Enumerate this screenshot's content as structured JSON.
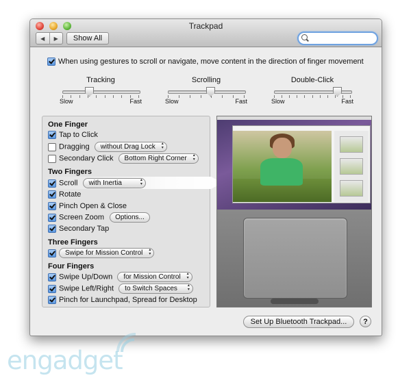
{
  "window": {
    "title": "Trackpad"
  },
  "toolbar": {
    "back_icon": "◀",
    "forward_icon": "▶",
    "show_all_label": "Show All",
    "search_value": ""
  },
  "gesture_pref": {
    "label": "When using gestures to scroll or navigate, move content in the direction of finger movement",
    "checked": true
  },
  "sliders": [
    {
      "label": "Tracking",
      "min_label": "Slow",
      "max_label": "Fast",
      "value": 0.35,
      "ticks": 10
    },
    {
      "label": "Scrolling",
      "min_label": "Slow",
      "max_label": "Fast",
      "value": 0.55,
      "ticks": 8
    },
    {
      "label": "Double-Click",
      "min_label": "Slow",
      "max_label": "Fast",
      "value": 0.82,
      "ticks": 11
    }
  ],
  "one_finger": {
    "heading": "One Finger",
    "tap_to_click": {
      "label": "Tap to Click",
      "checked": true
    },
    "dragging": {
      "label": "Dragging",
      "checked": false,
      "option": "without Drag Lock"
    },
    "secondary_click": {
      "label": "Secondary Click",
      "checked": false,
      "option": "Bottom Right Corner"
    }
  },
  "two_fingers": {
    "heading": "Two Fingers",
    "scroll": {
      "label": "Scroll",
      "checked": true,
      "option": "with Inertia"
    },
    "rotate": {
      "label": "Rotate",
      "checked": true
    },
    "pinch": {
      "label": "Pinch Open & Close",
      "checked": true
    },
    "screen_zoom": {
      "label": "Screen Zoom",
      "checked": true,
      "button": "Options..."
    },
    "secondary_tap": {
      "label": "Secondary Tap",
      "checked": true
    }
  },
  "three_fingers": {
    "heading": "Three Fingers",
    "swipe": {
      "checked": true,
      "option": "Swipe for Mission Control"
    }
  },
  "four_fingers": {
    "heading": "Four Fingers",
    "swipe_updown": {
      "label": "Swipe Up/Down",
      "checked": true,
      "option": "for Mission Control"
    },
    "swipe_leftright": {
      "label": "Swipe Left/Right",
      "checked": true,
      "option": "to Switch Spaces"
    },
    "pinch_launchpad": {
      "label": "Pinch for Launchpad, Spread for Desktop",
      "checked": true
    }
  },
  "footer": {
    "bluetooth_button": "Set Up Bluetooth Trackpad...",
    "help_button": "?"
  },
  "watermark": {
    "text": "engadget"
  }
}
